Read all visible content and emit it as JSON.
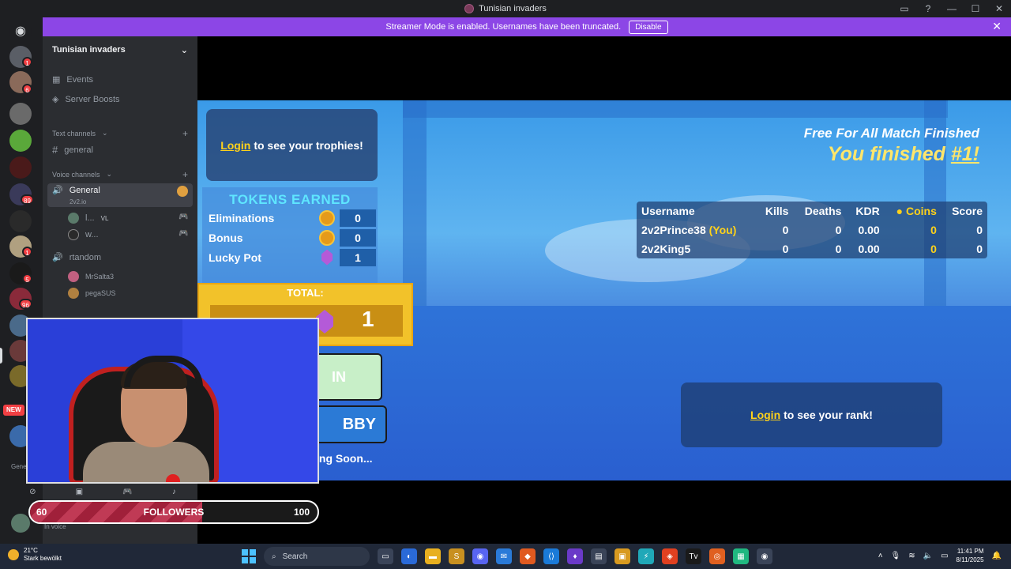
{
  "window": {
    "title": "Tunisian invaders"
  },
  "banner": {
    "text": "Streamer Mode is enabled. Usernames have been truncated.",
    "disable_label": "Disable"
  },
  "rail": {
    "badges": [
      "1",
      "6",
      "89",
      "1",
      "5",
      "96"
    ],
    "new_label": "NEW"
  },
  "sidebar": {
    "server_name": "Tunisian invaders",
    "events_label": "Events",
    "boosts_label": "Server Boosts",
    "text_channels_label": "Text channels",
    "general_text": "general",
    "voice_channels_label": "Voice channels",
    "voice_general": "General",
    "voice_general_sub": "2v2.io",
    "user1": "l...",
    "user1_tag": "VL",
    "user2": "w...",
    "voice_random": "rtandom",
    "user3": "MrSalta3",
    "user4": "pegaSUS",
    "panel_channel": "Gene",
    "panel_status": "In voice"
  },
  "game": {
    "trophies_login": "Login",
    "trophies_text": "to see your trophies!",
    "tokens_title": "TOKENS EARNED",
    "tokens": [
      {
        "label": "Eliminations",
        "value": "0"
      },
      {
        "label": "Bonus",
        "value": "0"
      },
      {
        "label": "Lucky Pot",
        "value": "1"
      }
    ],
    "total_label": "TOTAL:",
    "total_value": "1",
    "btn1_label": "IN",
    "btn2_label": "BBY",
    "soon_label": "ing Soon...",
    "match_title": "Free For All Match Finished",
    "match_result_prefix": "You finished",
    "match_rank": "#1!",
    "board": {
      "headers": [
        "Username",
        "Kills",
        "Deaths",
        "KDR",
        "Coins",
        "Score"
      ],
      "rows": [
        {
          "name": "2v2Prince38",
          "you": "(You)",
          "kills": "0",
          "deaths": "0",
          "kdr": "0.00",
          "coins": "0",
          "score": "0"
        },
        {
          "name": "2v2King5",
          "you": "",
          "kills": "0",
          "deaths": "0",
          "kdr": "0.00",
          "coins": "0",
          "score": "0"
        }
      ]
    },
    "rank_login": "Login",
    "rank_text": "to see your rank!"
  },
  "overlay": {
    "followers_current": "60",
    "followers_label": "FOLLOWERS",
    "followers_goal": "100",
    "followers_progress": 0.6
  },
  "taskbar": {
    "temp": "21°C",
    "weather": "Stark bewölkt",
    "search_placeholder": "Search",
    "time": "11:41 PM",
    "date": "8/11/2025"
  },
  "colors": {
    "banner": "#8c46e6",
    "accent_gold": "#ffd21a",
    "tokens_title": "#5fe6ff"
  }
}
